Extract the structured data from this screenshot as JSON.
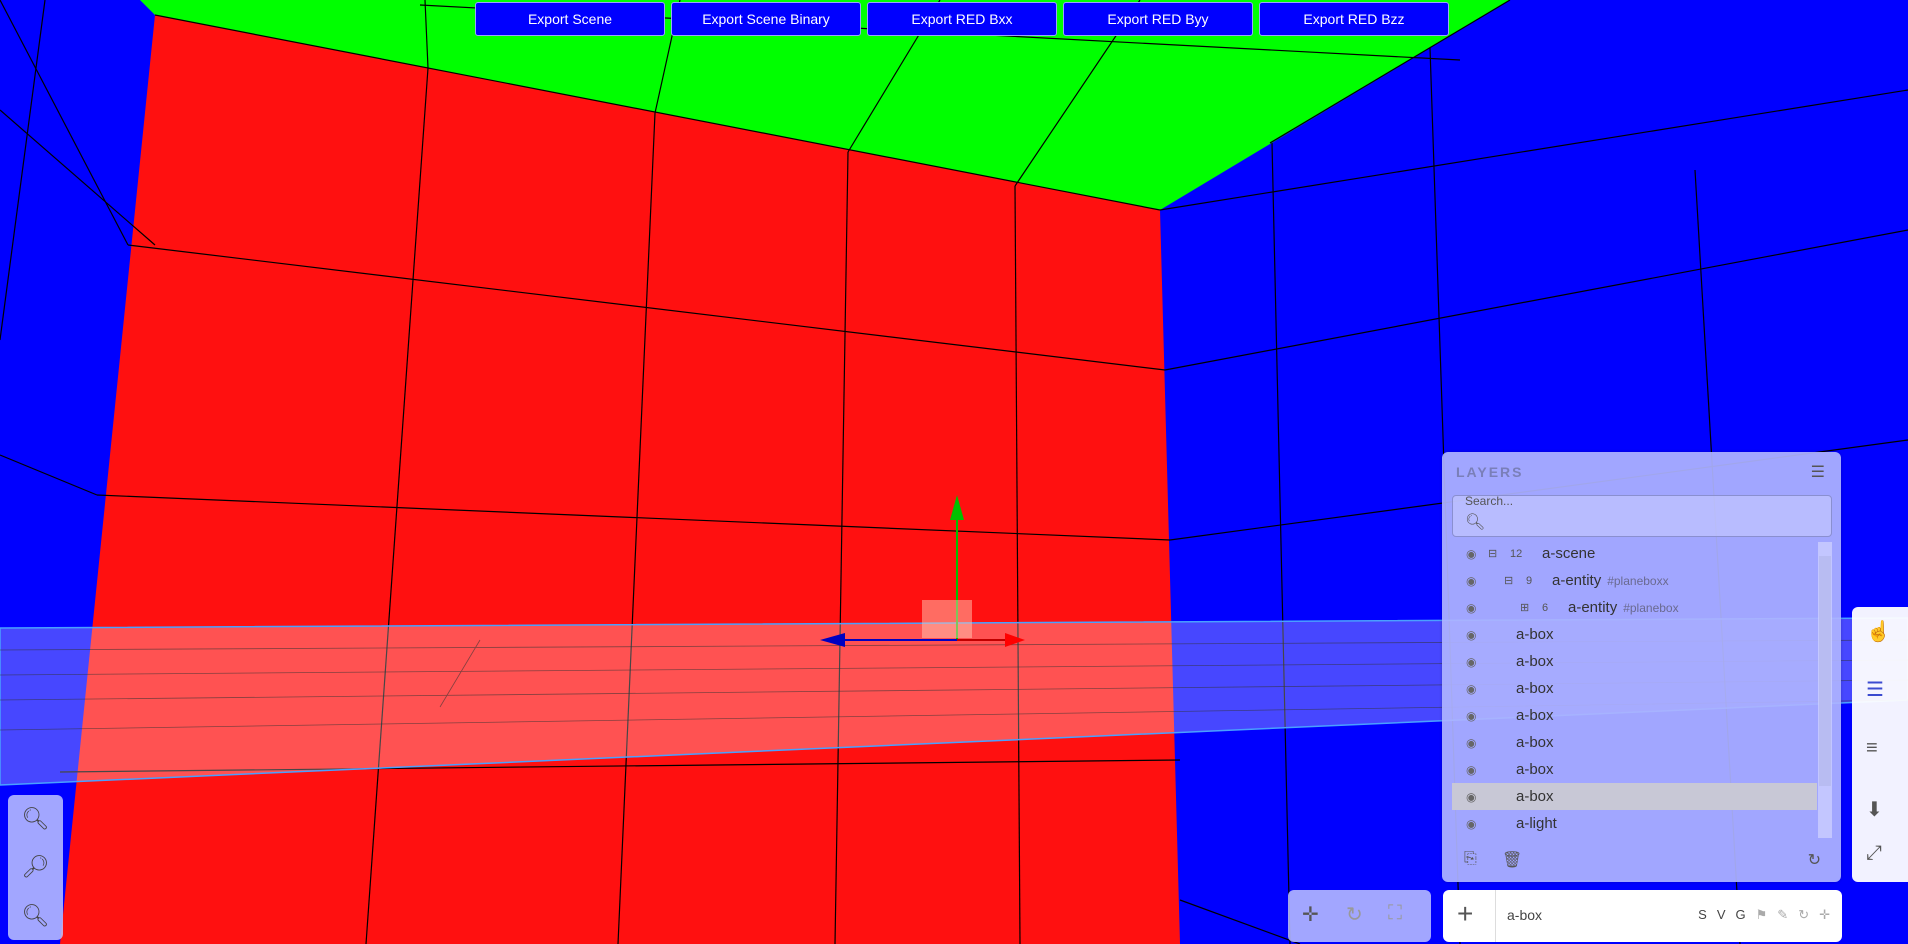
{
  "toolbar": {
    "buttons": [
      "Export Scene",
      "Export Scene Binary",
      "Export RED Bxx",
      "Export RED Byy",
      "Export RED Bzz"
    ]
  },
  "zoom": {
    "icons": [
      "zoom-in-icon",
      "zoom-reset-icon",
      "zoom-out-icon"
    ]
  },
  "layers": {
    "title": "LAYERS",
    "search_label": "Search...",
    "tree": [
      {
        "name": "a-scene",
        "count": "12",
        "expand": "minus",
        "depth": 0
      },
      {
        "name": "a-entity",
        "id": "#planeboxx",
        "count": "9",
        "expand": "minus",
        "depth": 1
      },
      {
        "name": "a-entity",
        "id": "#planebox",
        "count": "6",
        "expand": "plus",
        "depth": 2
      },
      {
        "name": "a-box",
        "depth": 0,
        "leaf": true
      },
      {
        "name": "a-box",
        "depth": 0,
        "leaf": true
      },
      {
        "name": "a-box",
        "depth": 0,
        "leaf": true
      },
      {
        "name": "a-box",
        "depth": 0,
        "leaf": true
      },
      {
        "name": "a-box",
        "depth": 0,
        "leaf": true
      },
      {
        "name": "a-box",
        "depth": 0,
        "leaf": true
      },
      {
        "name": "a-box",
        "depth": 0,
        "leaf": true,
        "selected": true
      },
      {
        "name": "a-light",
        "depth": 0,
        "leaf": true
      }
    ]
  },
  "bottom_bar": {
    "selected_tag": "a-box",
    "tools": [
      "S",
      "V",
      "G"
    ]
  },
  "colors": {
    "accent": "#0000ff",
    "wall_red": "#ff1010",
    "ceiling_green": "#00ff00",
    "panel": "#b0b4ff"
  }
}
